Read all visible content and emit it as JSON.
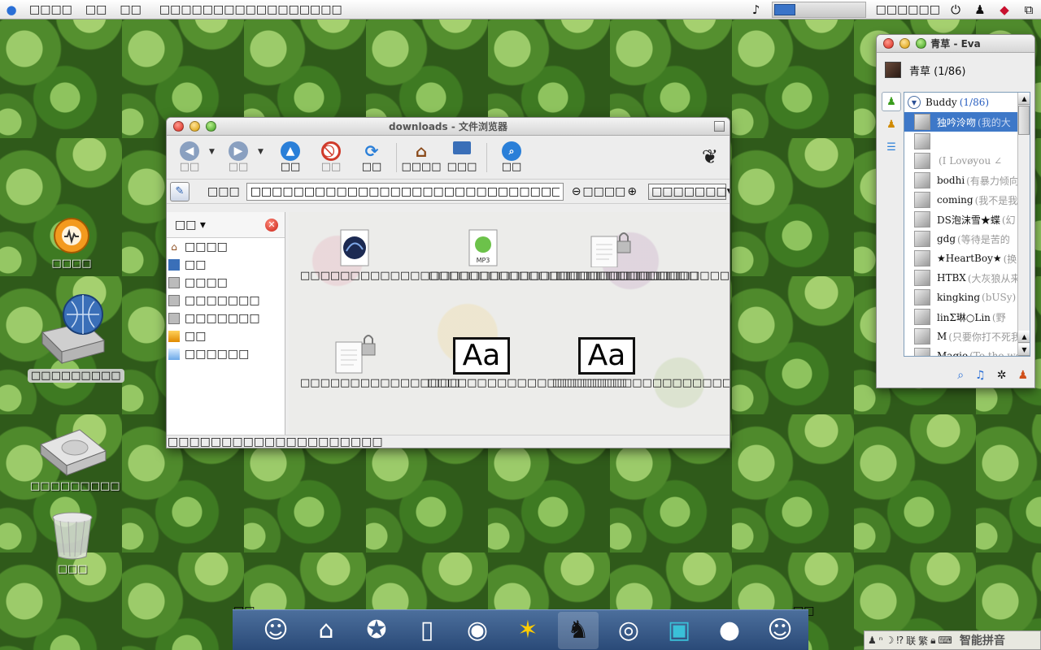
{
  "menubar": {
    "app_menu": "□□□□",
    "menu_items": [
      "□□",
      "□□"
    ],
    "window_title": "□□□□□□□□□□□□□□□□□",
    "clock": "□□□□□□"
  },
  "desktop_icons": [
    {
      "label": "□□□□"
    },
    {
      "label": "□□□□□□□□□"
    },
    {
      "label": "□□□□□□□□□"
    },
    {
      "label": "□□□"
    }
  ],
  "file_browser": {
    "title": "downloads - 文件浏览器",
    "toolbar": {
      "back": "□□",
      "forward": "□□",
      "up": "□□",
      "stop": "□□",
      "reload": "□□",
      "home": "□□□□",
      "computer": "□□□",
      "search": "□□"
    },
    "location_label": "□□□",
    "location_value": "□□□□□□□□□□□□□□□□□□□□□□□□□□□□□□□□□□□□□",
    "zoom_value": "□□□□",
    "view_mode": "□□□□□□□",
    "sidebar_title": "□□",
    "sidebar_items": [
      {
        "label": "□□□□",
        "icon": "home-icon"
      },
      {
        "label": "□□",
        "icon": "desktop-icon"
      },
      {
        "label": "□□□□",
        "icon": "drive-icon"
      },
      {
        "label": "□□□□□□□",
        "icon": "drive-icon"
      },
      {
        "label": "□□□□□□□",
        "icon": "drive-icon"
      },
      {
        "label": "□□",
        "icon": "trash-icon"
      },
      {
        "label": "□□□□□□",
        "icon": "folder-icon"
      }
    ],
    "files": [
      {
        "name": "□□□□□□□□□□□□□□□□□□□□□□□□□□□□□□□□□□□□□□□□□□□□□□□□□□□□□□□□",
        "icon": "image-icon"
      },
      {
        "name": "□□□□□□□□□□□□□□□□□□□□□□□□□□□",
        "icon": "mp3-icon",
        "badge": "MP3"
      },
      {
        "name": "□□□□□□□□□□□□□",
        "icon": "locked-document-icon"
      },
      {
        "name": "□□□□□□□□□□□□□□□□",
        "icon": "locked-document-icon"
      },
      {
        "name": "□□□□□□□□□□□□□□□□□□□□",
        "icon": "font-icon",
        "glyph": "Aa"
      },
      {
        "name": "□□□□□□□□□□□□□□□□□□□□□□□",
        "icon": "font-icon",
        "glyph": "Aa"
      }
    ],
    "status": "□□□□□□□□□□□□□□□□□□□□"
  },
  "im": {
    "title": "青草 - Eva",
    "self_name": "青草 (1/86)",
    "group": {
      "name": "Buddy",
      "count": "(1/86)"
    },
    "buddies": [
      {
        "name": "独吟泠吻",
        "sig": "(我的大",
        "selected": true
      },
      {
        "name": "",
        "sig": ""
      },
      {
        "name": "",
        "sig": "(I Lovøyou ∠"
      },
      {
        "name": "bodhi",
        "sig": "(有暴力倾向"
      },
      {
        "name": "coming",
        "sig": "(我不是我"
      },
      {
        "name": "DS泡沫雪★蝶",
        "sig": "(幻"
      },
      {
        "name": "gdg",
        "sig": "(等待是苦的"
      },
      {
        "name": "★HeartBoy★",
        "sig": "(换"
      },
      {
        "name": "HTBX",
        "sig": "(大灰狼从来"
      },
      {
        "name": "kingking",
        "sig": "(bUSy)"
      },
      {
        "name": "linΣ琳○Lin",
        "sig": "(野"
      },
      {
        "name": "M",
        "sig": "(只要你打不死我"
      },
      {
        "name": "Magie",
        "sig": "(To the wor"
      }
    ]
  },
  "dock": {
    "marker_left": "□□",
    "marker_right": "□□",
    "items": [
      "finder-icon",
      "home-icon",
      "safari-icon",
      "ipod-icon",
      "ichat-icon",
      "aim-icon",
      "qq-penguin-icon",
      "speaker-icon",
      "photo-booth-icon",
      "apple-icon",
      "finder-icon"
    ]
  },
  "ime": {
    "mode_text": "联",
    "mode_text2": "繁",
    "name": "智能拼音"
  },
  "colors": {
    "dock_top": "#4c6f9c",
    "selection": "#3e78c8",
    "accent_blue": "#2a6fd6"
  }
}
